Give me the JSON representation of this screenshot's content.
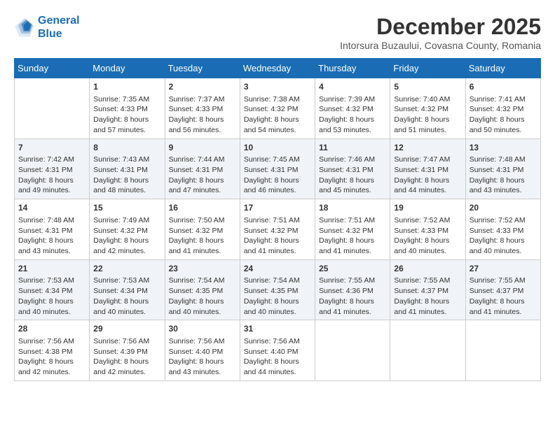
{
  "logo": {
    "line1": "General",
    "line2": "Blue"
  },
  "title": "December 2025",
  "location": "Intorsura Buzaului, Covasna County, Romania",
  "days_of_week": [
    "Sunday",
    "Monday",
    "Tuesday",
    "Wednesday",
    "Thursday",
    "Friday",
    "Saturday"
  ],
  "weeks": [
    [
      {
        "day": "",
        "content": ""
      },
      {
        "day": "1",
        "content": "Sunrise: 7:35 AM\nSunset: 4:33 PM\nDaylight: 8 hours\nand 57 minutes."
      },
      {
        "day": "2",
        "content": "Sunrise: 7:37 AM\nSunset: 4:33 PM\nDaylight: 8 hours\nand 56 minutes."
      },
      {
        "day": "3",
        "content": "Sunrise: 7:38 AM\nSunset: 4:32 PM\nDaylight: 8 hours\nand 54 minutes."
      },
      {
        "day": "4",
        "content": "Sunrise: 7:39 AM\nSunset: 4:32 PM\nDaylight: 8 hours\nand 53 minutes."
      },
      {
        "day": "5",
        "content": "Sunrise: 7:40 AM\nSunset: 4:32 PM\nDaylight: 8 hours\nand 51 minutes."
      },
      {
        "day": "6",
        "content": "Sunrise: 7:41 AM\nSunset: 4:32 PM\nDaylight: 8 hours\nand 50 minutes."
      }
    ],
    [
      {
        "day": "7",
        "content": "Sunrise: 7:42 AM\nSunset: 4:31 PM\nDaylight: 8 hours\nand 49 minutes."
      },
      {
        "day": "8",
        "content": "Sunrise: 7:43 AM\nSunset: 4:31 PM\nDaylight: 8 hours\nand 48 minutes."
      },
      {
        "day": "9",
        "content": "Sunrise: 7:44 AM\nSunset: 4:31 PM\nDaylight: 8 hours\nand 47 minutes."
      },
      {
        "day": "10",
        "content": "Sunrise: 7:45 AM\nSunset: 4:31 PM\nDaylight: 8 hours\nand 46 minutes."
      },
      {
        "day": "11",
        "content": "Sunrise: 7:46 AM\nSunset: 4:31 PM\nDaylight: 8 hours\nand 45 minutes."
      },
      {
        "day": "12",
        "content": "Sunrise: 7:47 AM\nSunset: 4:31 PM\nDaylight: 8 hours\nand 44 minutes."
      },
      {
        "day": "13",
        "content": "Sunrise: 7:48 AM\nSunset: 4:31 PM\nDaylight: 8 hours\nand 43 minutes."
      }
    ],
    [
      {
        "day": "14",
        "content": "Sunrise: 7:48 AM\nSunset: 4:31 PM\nDaylight: 8 hours\nand 43 minutes."
      },
      {
        "day": "15",
        "content": "Sunrise: 7:49 AM\nSunset: 4:32 PM\nDaylight: 8 hours\nand 42 minutes."
      },
      {
        "day": "16",
        "content": "Sunrise: 7:50 AM\nSunset: 4:32 PM\nDaylight: 8 hours\nand 41 minutes."
      },
      {
        "day": "17",
        "content": "Sunrise: 7:51 AM\nSunset: 4:32 PM\nDaylight: 8 hours\nand 41 minutes."
      },
      {
        "day": "18",
        "content": "Sunrise: 7:51 AM\nSunset: 4:32 PM\nDaylight: 8 hours\nand 41 minutes."
      },
      {
        "day": "19",
        "content": "Sunrise: 7:52 AM\nSunset: 4:33 PM\nDaylight: 8 hours\nand 40 minutes."
      },
      {
        "day": "20",
        "content": "Sunrise: 7:52 AM\nSunset: 4:33 PM\nDaylight: 8 hours\nand 40 minutes."
      }
    ],
    [
      {
        "day": "21",
        "content": "Sunrise: 7:53 AM\nSunset: 4:34 PM\nDaylight: 8 hours\nand 40 minutes."
      },
      {
        "day": "22",
        "content": "Sunrise: 7:53 AM\nSunset: 4:34 PM\nDaylight: 8 hours\nand 40 minutes."
      },
      {
        "day": "23",
        "content": "Sunrise: 7:54 AM\nSunset: 4:35 PM\nDaylight: 8 hours\nand 40 minutes."
      },
      {
        "day": "24",
        "content": "Sunrise: 7:54 AM\nSunset: 4:35 PM\nDaylight: 8 hours\nand 40 minutes."
      },
      {
        "day": "25",
        "content": "Sunrise: 7:55 AM\nSunset: 4:36 PM\nDaylight: 8 hours\nand 41 minutes."
      },
      {
        "day": "26",
        "content": "Sunrise: 7:55 AM\nSunset: 4:37 PM\nDaylight: 8 hours\nand 41 minutes."
      },
      {
        "day": "27",
        "content": "Sunrise: 7:55 AM\nSunset: 4:37 PM\nDaylight: 8 hours\nand 41 minutes."
      }
    ],
    [
      {
        "day": "28",
        "content": "Sunrise: 7:56 AM\nSunset: 4:38 PM\nDaylight: 8 hours\nand 42 minutes."
      },
      {
        "day": "29",
        "content": "Sunrise: 7:56 AM\nSunset: 4:39 PM\nDaylight: 8 hours\nand 42 minutes."
      },
      {
        "day": "30",
        "content": "Sunrise: 7:56 AM\nSunset: 4:40 PM\nDaylight: 8 hours\nand 43 minutes."
      },
      {
        "day": "31",
        "content": "Sunrise: 7:56 AM\nSunset: 4:40 PM\nDaylight: 8 hours\nand 44 minutes."
      },
      {
        "day": "",
        "content": ""
      },
      {
        "day": "",
        "content": ""
      },
      {
        "day": "",
        "content": ""
      }
    ]
  ]
}
